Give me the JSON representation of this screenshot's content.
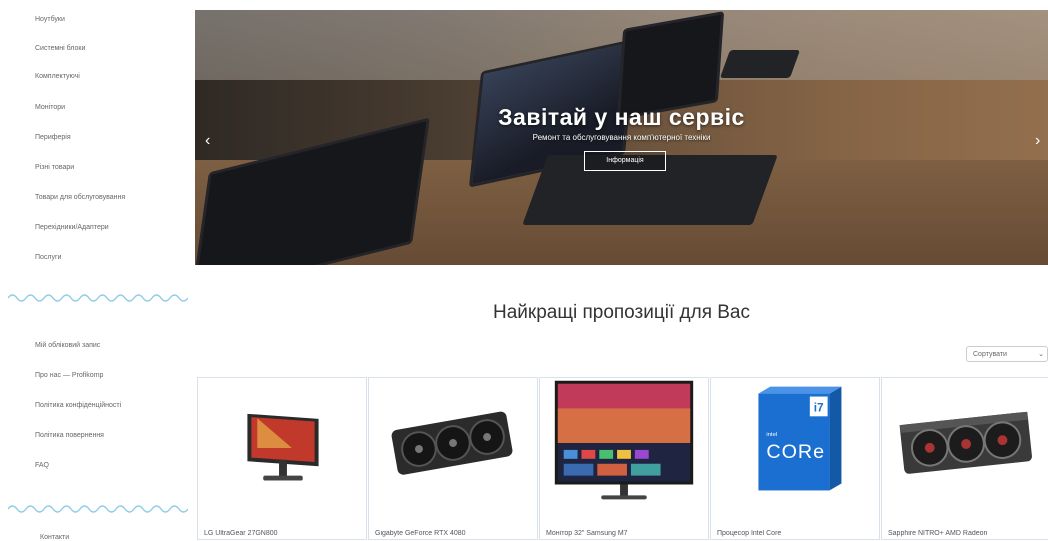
{
  "sidebar": {
    "categories": [
      "Ноутбуки",
      "Системні блоки",
      "Комплектуючі",
      "Монітори",
      "Периферія",
      "Різні товари",
      "Товари для обслуговування",
      "Перехідники/Адаптери",
      "Послуги"
    ],
    "info_links": [
      "Мій обліковий запис",
      "Про нас — Profikomp",
      "Політика конфіденційності",
      "Політика повернення",
      "FAQ"
    ],
    "bottom_label": "Контакти"
  },
  "banner": {
    "title": "Завітай у наш сервіс",
    "subtitle": "Ремонт та обслуговування комп'ютерної техніки",
    "button_label": "Інформація",
    "prev_arrow": "‹",
    "next_arrow": "›"
  },
  "offers": {
    "title": "Найкращі пропозиції для Вас",
    "sort_label": "Сортувати",
    "sort_chevron": "⌄",
    "products": [
      {
        "name": "LG UltraGear 27GN800"
      },
      {
        "name": "Gigabyte GeForce RTX 4080"
      },
      {
        "name": "Монітор 32\" Samsung M7"
      },
      {
        "name": "Процесор Intel Core"
      },
      {
        "name": "Sapphire NITRO+ AMD Radeon"
      }
    ]
  },
  "colors": {
    "wave": "#8ecbe6",
    "card_border": "#d8e2ec",
    "intel_blue": "#1a6fd0"
  }
}
